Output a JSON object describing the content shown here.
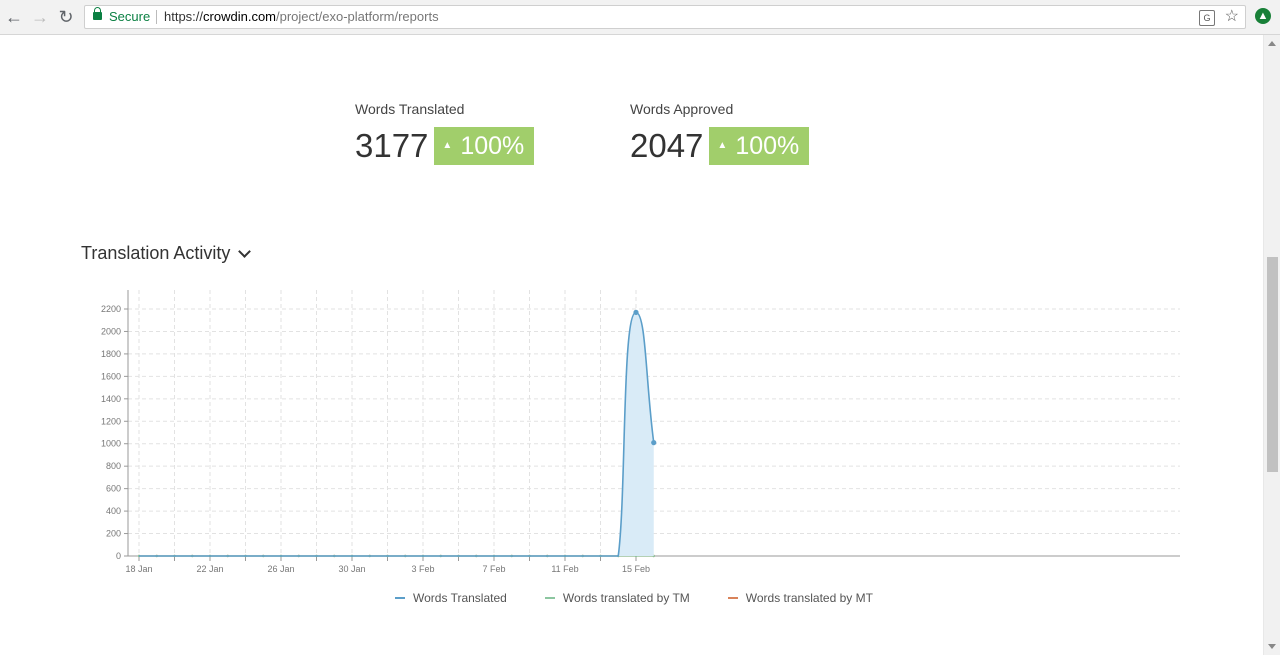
{
  "browser": {
    "secure_label": "Secure",
    "url_scheme": "https://",
    "url_host": "crowdin.com",
    "url_path": "/project/exo-platform/reports"
  },
  "stats": [
    {
      "label": "Words Translated",
      "value": "3177",
      "change": "100%"
    },
    {
      "label": "Words Approved",
      "value": "2047",
      "change": "100%"
    }
  ],
  "section": {
    "title": "Translation Activity"
  },
  "chart_data": {
    "type": "area",
    "title": "",
    "xlabel": "",
    "ylabel": "",
    "ylim": [
      0,
      2200
    ],
    "y_ticks": [
      0,
      200,
      400,
      600,
      800,
      1000,
      1200,
      1400,
      1600,
      1800,
      2000,
      2200
    ],
    "x_tick_labels": [
      "18 Jan",
      "22 Jan",
      "26 Jan",
      "30 Jan",
      "3 Feb",
      "7 Feb",
      "11 Feb",
      "15 Feb"
    ],
    "x_start": "18 Jan",
    "x_days": [
      "18 Jan",
      "19 Jan",
      "20 Jan",
      "21 Jan",
      "22 Jan",
      "23 Jan",
      "24 Jan",
      "25 Jan",
      "26 Jan",
      "27 Jan",
      "28 Jan",
      "29 Jan",
      "30 Jan",
      "31 Jan",
      "1 Feb",
      "2 Feb",
      "3 Feb",
      "4 Feb",
      "5 Feb",
      "6 Feb",
      "7 Feb",
      "8 Feb",
      "9 Feb",
      "10 Feb",
      "11 Feb",
      "12 Feb",
      "13 Feb",
      "14 Feb",
      "15 Feb",
      "16 Feb"
    ],
    "grid": true,
    "legend_position": "bottom",
    "series": [
      {
        "name": "Words Translated",
        "color": "#5b9ec9",
        "values": [
          0,
          0,
          0,
          0,
          0,
          0,
          0,
          0,
          0,
          0,
          0,
          0,
          0,
          0,
          0,
          0,
          0,
          0,
          0,
          0,
          0,
          0,
          0,
          0,
          0,
          0,
          0,
          0,
          2170,
          1010
        ]
      },
      {
        "name": "Words translated by TM",
        "color": "#8cc6a0",
        "values": [
          0,
          0,
          0,
          0,
          0,
          0,
          0,
          0,
          0,
          0,
          0,
          0,
          0,
          0,
          0,
          0,
          0,
          0,
          0,
          0,
          0,
          0,
          0,
          0,
          0,
          0,
          0,
          0,
          0,
          0
        ]
      },
      {
        "name": "Words translated by MT",
        "color": "#d9835a",
        "values": [
          0,
          0,
          0,
          0,
          0,
          0,
          0,
          0,
          0,
          0,
          0,
          0,
          0,
          0,
          0,
          0,
          0,
          0,
          0,
          0,
          0,
          0,
          0,
          0,
          0,
          0,
          0,
          0,
          0,
          0
        ]
      }
    ]
  }
}
